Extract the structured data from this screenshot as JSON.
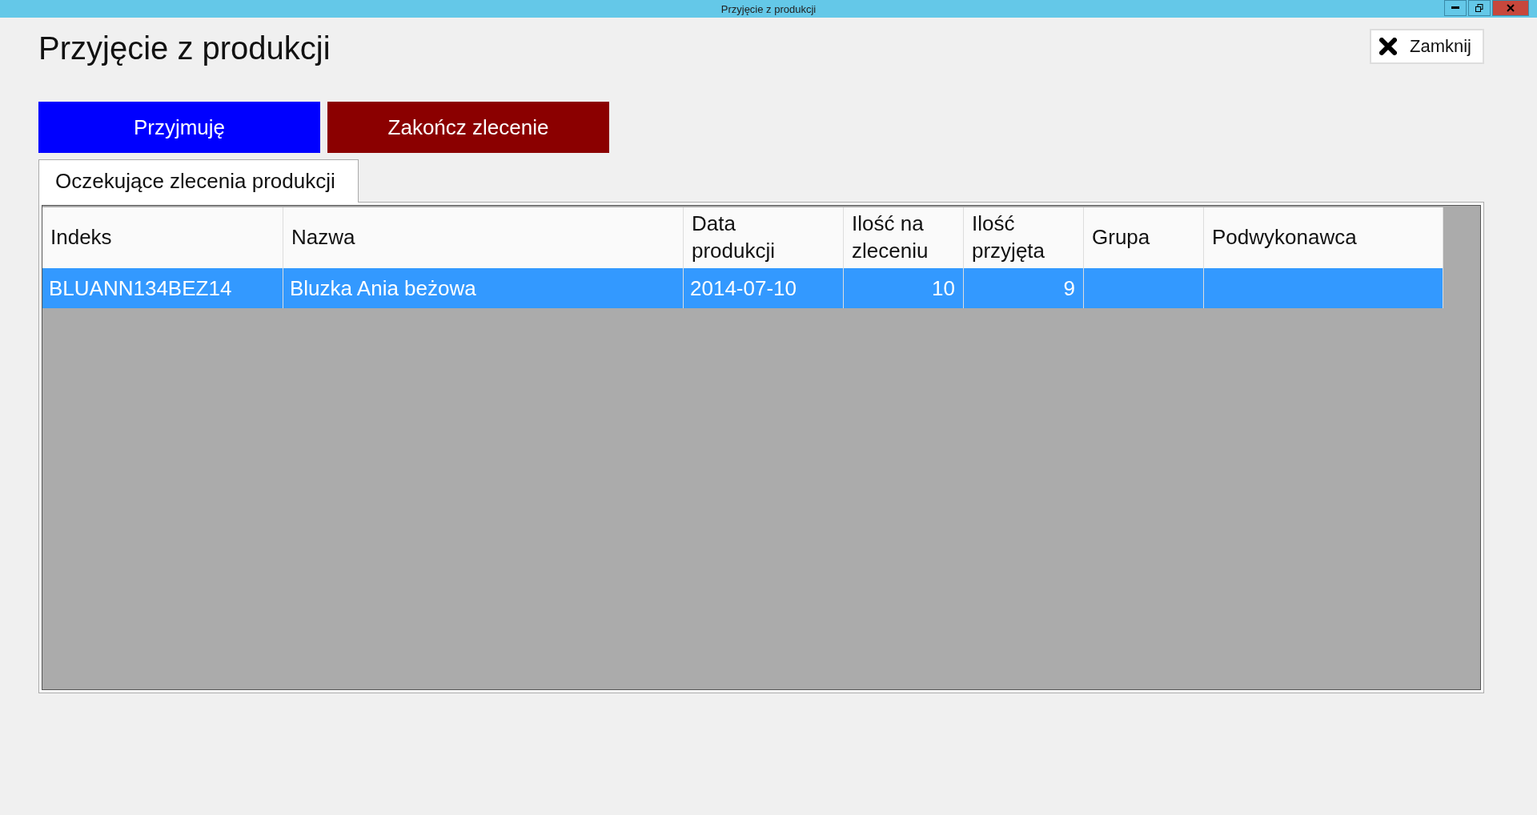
{
  "window": {
    "title": "Przyjęcie z produkcji"
  },
  "heading": "Przyjęcie z produkcji",
  "close_button": {
    "label": "Zamknij"
  },
  "actions": [
    {
      "label": "Przyjmuję",
      "color": "#0000ff"
    },
    {
      "label": "Zakończ zlecenie",
      "color": "#8b0000"
    }
  ],
  "tabs": [
    {
      "label": "Oczekujące zlecenia produkcji",
      "selected": true
    }
  ],
  "table": {
    "columns": [
      {
        "label": "Indeks",
        "kind": "text"
      },
      {
        "label": "Nazwa",
        "kind": "text"
      },
      {
        "label": "Data produkcji",
        "kind": "text"
      },
      {
        "label": "Ilość na zleceniu",
        "kind": "number"
      },
      {
        "label": "Ilość przyjęta",
        "kind": "number"
      },
      {
        "label": "Grupa",
        "kind": "text"
      },
      {
        "label": "Podwykonawca",
        "kind": "text"
      }
    ],
    "rows": [
      {
        "selected": true,
        "cells": [
          "BLUANN134BEZ14",
          "Bluzka Ania beżowa",
          "2014-07-10",
          "10",
          "9",
          "",
          ""
        ]
      }
    ]
  }
}
